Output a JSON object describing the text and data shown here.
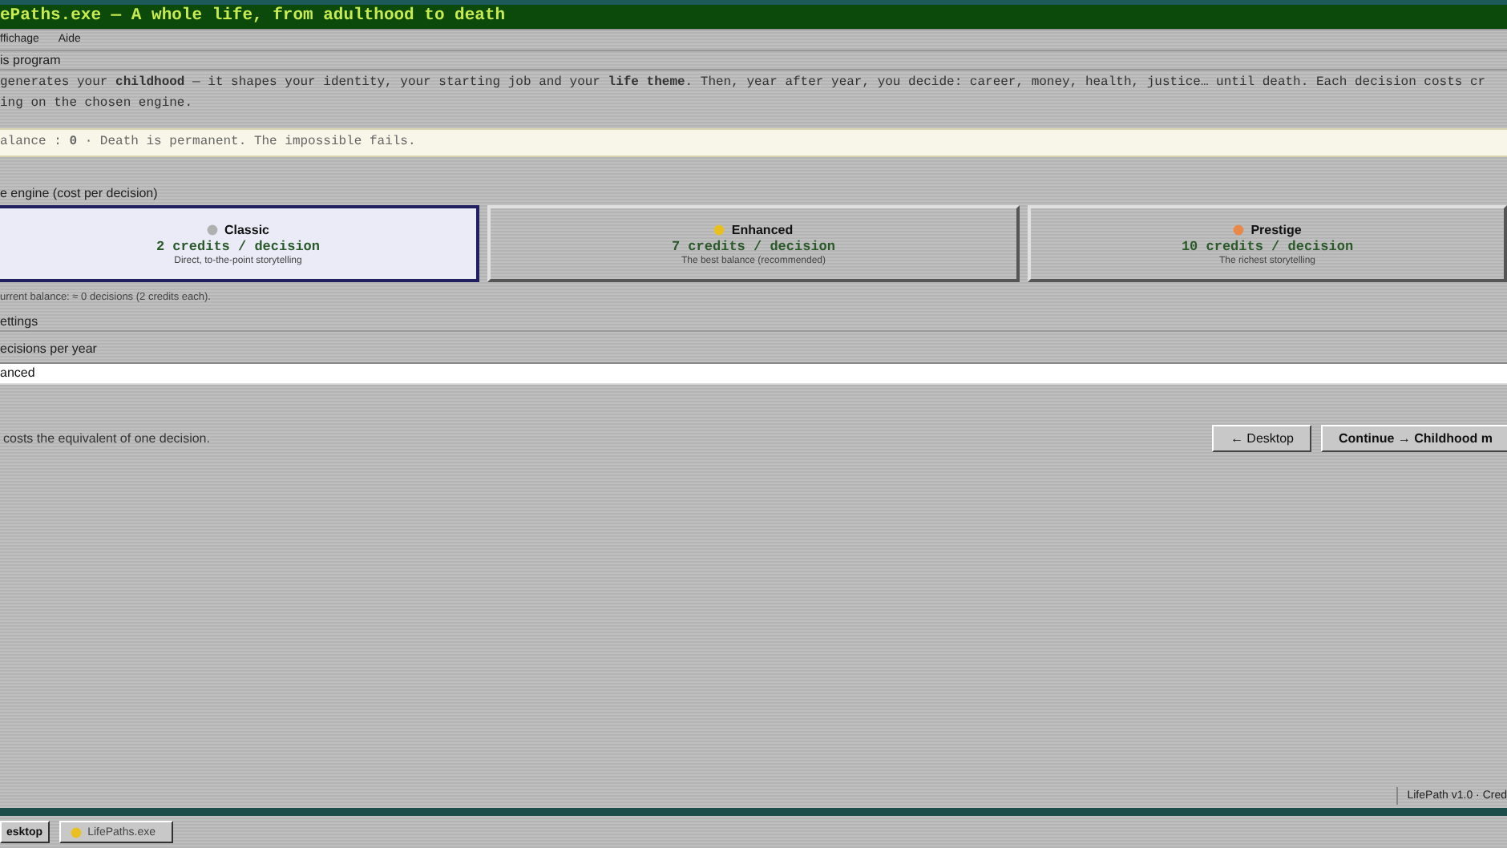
{
  "window": {
    "title": "ePaths.exe — A whole life, from adulthood to death"
  },
  "menu": [
    "ffichage",
    "Aide"
  ],
  "intro": {
    "heading": "is program",
    "lines": [
      "generates your **childhood** — it shapes your identity, your starting job and your **life theme**. Then, year after year, you decide: career, money, health, justice… until death. Each decision costs cr",
      "ing on the chosen engine."
    ]
  },
  "notice": "alance : **0** · Death is permanent. The impossible fails.",
  "engine": {
    "legend": "e engine (cost per decision)",
    "options": [
      {
        "name": "Classic",
        "cost": "2 credits / decision",
        "description": "Direct, to-the-point storytelling",
        "color": "#b0b0b0",
        "selected": true
      },
      {
        "name": "Enhanced",
        "cost": "7 credits / decision",
        "description": "The best balance (recommended)",
        "color": "#e8c020",
        "selected": false
      },
      {
        "name": "Prestige",
        "cost": "10 credits / decision",
        "description": "The richest storytelling",
        "color": "#e8884a",
        "selected": false
      }
    ],
    "note": "urrent balance: ≈ 0 decisions (2 credits each)."
  },
  "settings": {
    "legend": "ettings",
    "label": "ecisions per year",
    "value": "anced"
  },
  "footer": {
    "text": "costs the equivalent of one decision.",
    "buttons": [
      "← Desktop",
      "Continue → Childhood m"
    ]
  },
  "status_bar": "LifePath v1.0 · Cred",
  "taskbar": {
    "start": "esktop",
    "tasks": [
      "LifePaths.exe"
    ]
  }
}
